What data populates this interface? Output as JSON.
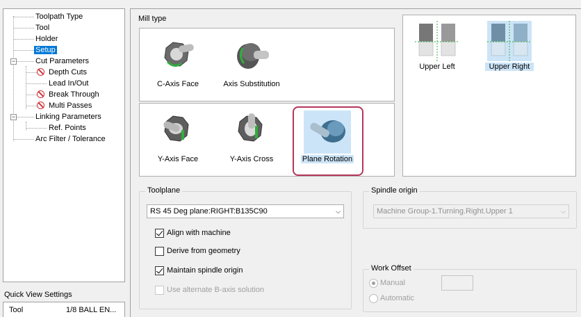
{
  "tree": {
    "items": [
      {
        "label": "Toolpath Type"
      },
      {
        "label": "Tool"
      },
      {
        "label": "Holder"
      },
      {
        "label": "Setup"
      },
      {
        "label": "Cut Parameters"
      },
      {
        "label": "Depth Cuts"
      },
      {
        "label": "Lead In/Out"
      },
      {
        "label": "Break Through"
      },
      {
        "label": "Multi Passes"
      },
      {
        "label": "Linking Parameters"
      },
      {
        "label": "Ref. Points"
      },
      {
        "label": "Arc Filter / Tolerance"
      }
    ]
  },
  "quick_view": {
    "title": "Quick View Settings",
    "rows": [
      {
        "key": "Tool",
        "value": "1/8 BALL EN..."
      }
    ]
  },
  "mill_type": {
    "title": "Mill type",
    "row1": [
      {
        "label": "C-Axis Face"
      },
      {
        "label": "Axis Substitution"
      }
    ],
    "row2": [
      {
        "label": "Y-Axis Face"
      },
      {
        "label": "Y-Axis Cross"
      },
      {
        "label": "Plane Rotation"
      }
    ]
  },
  "spindle_positions": [
    {
      "label": "Upper Left"
    },
    {
      "label": "Upper Right"
    }
  ],
  "toolplane": {
    "title": "Toolplane",
    "selected": "RS 45 Deg plane:RIGHT:B135C90",
    "options": {
      "align_with_machine": {
        "label": "Align with machine",
        "checked": true
      },
      "derive_from_geometry": {
        "label": "Derive from geometry",
        "checked": false
      },
      "maintain_spindle_origin": {
        "label": "Maintain spindle origin",
        "checked": true
      },
      "alternate_b_axis": {
        "label": "Use alternate B-axis solution",
        "checked": false
      }
    }
  },
  "spindle_origin": {
    "title": "Spindle origin",
    "selected": "Machine Group-1.Turning.Right.Upper 1"
  },
  "work_offset": {
    "title": "Work Offset",
    "manual": "Manual",
    "automatic": "Automatic",
    "value": ""
  },
  "colors": {
    "selection_blue": "#0078d7",
    "tile_highlight": "#cce4f7",
    "callout_ring": "#b5365a",
    "prohibited_red": "#d0323a"
  }
}
